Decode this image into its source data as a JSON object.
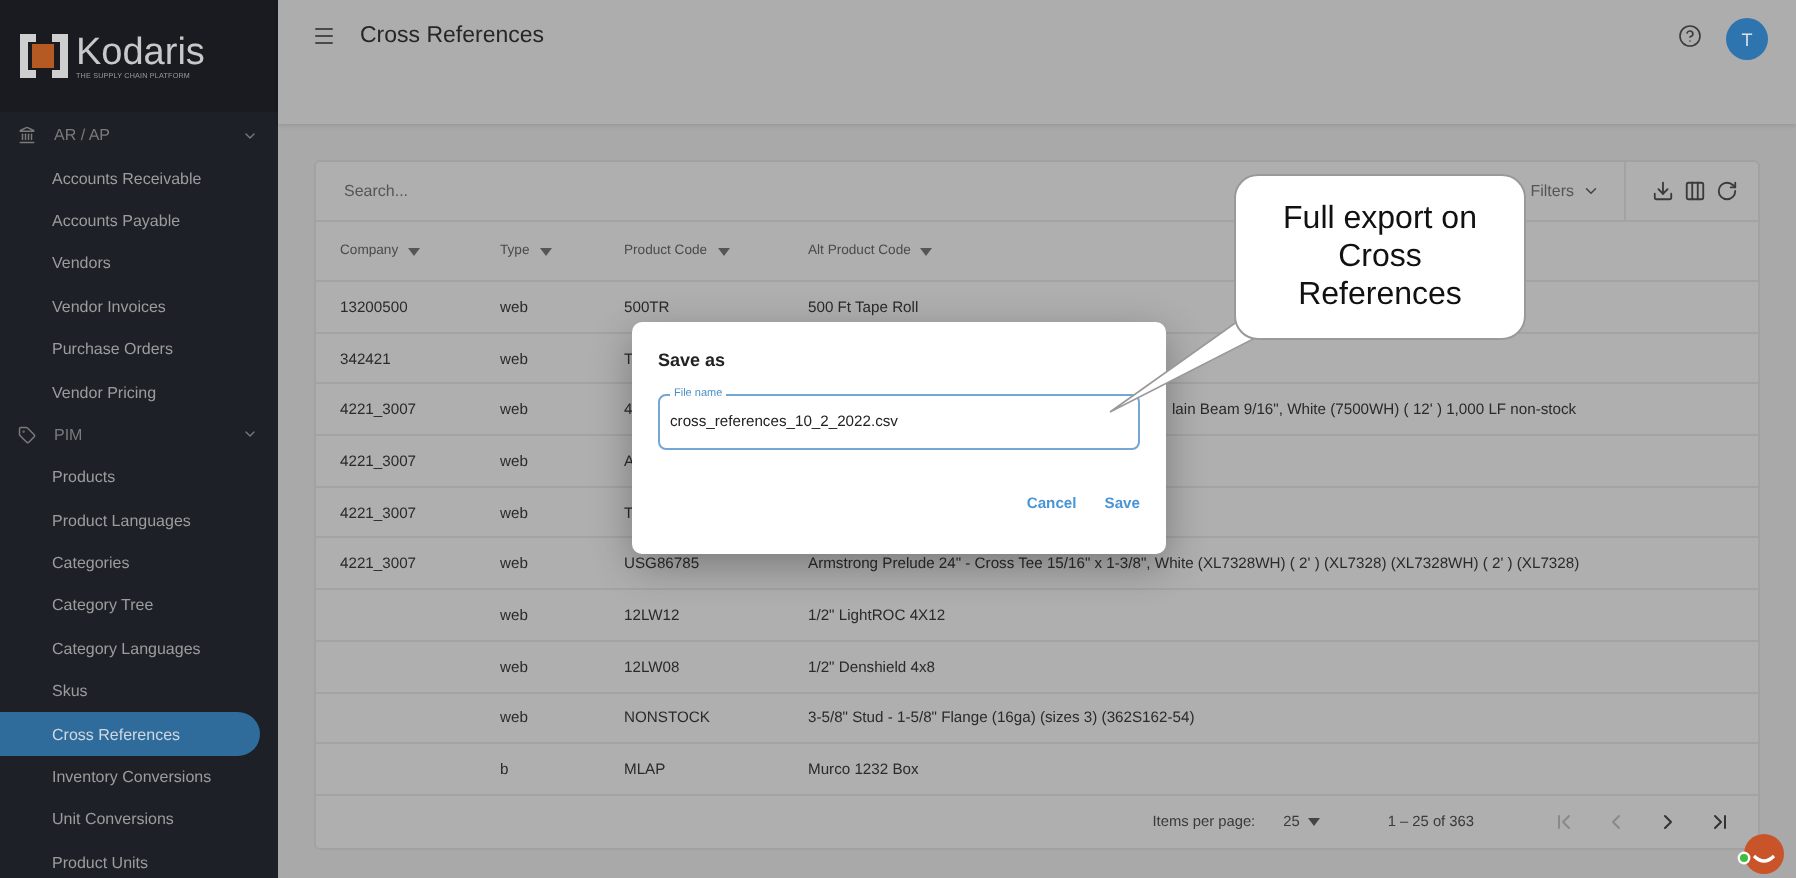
{
  "sidebar": {
    "logo": {
      "name": "Kodaris",
      "tagline": "THE SUPPLY CHAIN PLATFORM"
    },
    "groups": [
      {
        "label": "AR / AP",
        "expanded": true,
        "items": [
          {
            "label": "Accounts Receivable",
            "selected": false
          },
          {
            "label": "Accounts Payable",
            "selected": false
          },
          {
            "label": "Vendors",
            "selected": false
          },
          {
            "label": "Vendor Invoices",
            "selected": false
          },
          {
            "label": "Purchase Orders",
            "selected": false
          },
          {
            "label": "Vendor Pricing",
            "selected": false
          }
        ]
      },
      {
        "label": "PIM",
        "expanded": true,
        "items": [
          {
            "label": "Products",
            "selected": false
          },
          {
            "label": "Product Languages",
            "selected": false
          },
          {
            "label": "Categories",
            "selected": false
          },
          {
            "label": "Category Tree",
            "selected": false
          },
          {
            "label": "Category Languages",
            "selected": false
          },
          {
            "label": "Skus",
            "selected": false
          },
          {
            "label": "Cross References",
            "selected": true
          },
          {
            "label": "Inventory Conversions",
            "selected": false
          },
          {
            "label": "Unit Conversions",
            "selected": false
          },
          {
            "label": "Product Units",
            "selected": false
          }
        ]
      }
    ]
  },
  "header": {
    "title": "Cross References",
    "avatar": "T"
  },
  "table": {
    "search_placeholder": "Search...",
    "filters": "Filters",
    "columns": [
      "Company",
      "Type",
      "Product Code",
      "Alt Product Code"
    ],
    "rows": [
      {
        "company": "13200500",
        "type": "web",
        "product_code": "500TR",
        "alt_product_code": "500 Ft Tape Roll",
        "alt_after_dialog": false
      },
      {
        "company": "342421",
        "type": "web",
        "product_code": "T"
      },
      {
        "company": "4221_3007",
        "type": "web",
        "product_code": "4",
        "alt_product_code": "lain Beam 9/16\", White (7500WH) ( 12' ) 1,000 LF non-stock",
        "alt_after_dialog": true
      },
      {
        "company": "4221_3007",
        "type": "web",
        "product_code": "A"
      },
      {
        "company": "4221_3007",
        "type": "web",
        "product_code": "T"
      },
      {
        "company": "4221_3007",
        "type": "web",
        "product_code": "USG86785",
        "alt_product_code": "Armstrong Prelude 24\" - Cross Tee 15/16\" x 1-3/8\", White (XL7328WH) ( 2' ) (XL7328) (XL7328WH) ( 2' ) (XL7328)",
        "alt_after_dialog": false
      },
      {
        "type": "web",
        "product_code": "12LW12",
        "alt_product_code": "1/2\" LightROC 4X12",
        "alt_after_dialog": false
      },
      {
        "type": "web",
        "product_code": "12LW08",
        "alt_product_code": "1/2\" Denshield 4x8",
        "alt_after_dialog": false
      },
      {
        "type": "web",
        "product_code": "NONSTOCK",
        "alt_product_code": "3-5/8\" Stud - 1-5/8\" Flange (16ga) (sizes 3) (362S162-54)",
        "alt_after_dialog": false
      },
      {
        "type": "b",
        "product_code": "MLAP",
        "alt_product_code": "Murco 1232 Box",
        "alt_after_dialog": false
      }
    ],
    "pagination": {
      "items_per_page_label": "Items per page:",
      "items_per_page": "25",
      "range": "1 – 25 of 363"
    }
  },
  "dialog": {
    "title": "Save as",
    "field_label": "File name",
    "value": "cross_references_10_2_2022.csv",
    "buttons": [
      "Cancel",
      "Save"
    ]
  },
  "callout": {
    "text": "Full export on Cross References"
  }
}
